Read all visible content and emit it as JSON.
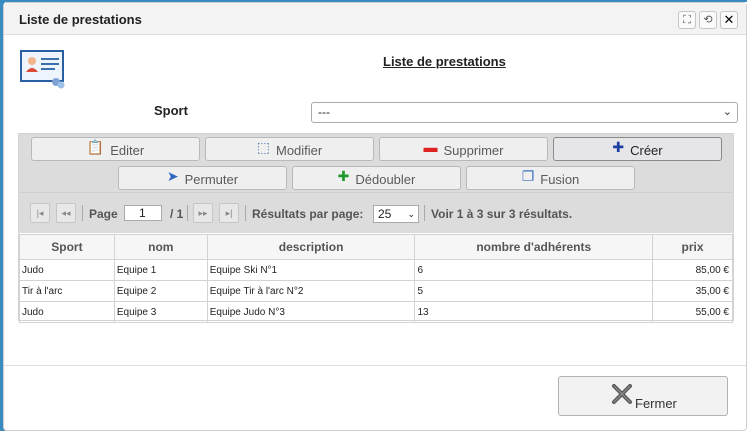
{
  "window": {
    "title": "Liste de prestations",
    "controls": [
      "expand-icon",
      "refresh-icon",
      "close-icon"
    ]
  },
  "page": {
    "heading": "Liste de prestations",
    "icon": "contact-card-icon"
  },
  "filter": {
    "sport_label": "Sport",
    "sport_value": "---"
  },
  "actions": {
    "editer": "Editer",
    "modifier": "Modifier",
    "supprimer": "Supprimer",
    "creer": "Créer",
    "permuter": "Permuter",
    "dedoubler": "Dédoubler",
    "fusion": "Fusion"
  },
  "pager": {
    "page_label": "Page",
    "page_value": "1",
    "page_total": "/ 1",
    "per_page_label": "Résultats par page:",
    "per_page_value": "25",
    "summary": "Voir 1 à 3 sur 3 résultats."
  },
  "table": {
    "columns": [
      "Sport",
      "nom",
      "description",
      "nombre d'adhérents",
      "prix"
    ],
    "rows": [
      [
        "Judo",
        "Equipe 1",
        "Equipe Ski N°1",
        "6",
        "85,00 €"
      ],
      [
        "Tir à l'arc",
        "Equipe 2",
        "Equipe Tir à l'arc N°2",
        "5",
        "35,00 €"
      ],
      [
        "Judo",
        "Equipe 3",
        "Equipe Judo N°3",
        "13",
        "55,00 €"
      ]
    ]
  },
  "footer": {
    "close_label": "Fermer"
  },
  "colors": {
    "toolbar_bg": "#dcdcdc",
    "accent": "#3a8cc0"
  }
}
